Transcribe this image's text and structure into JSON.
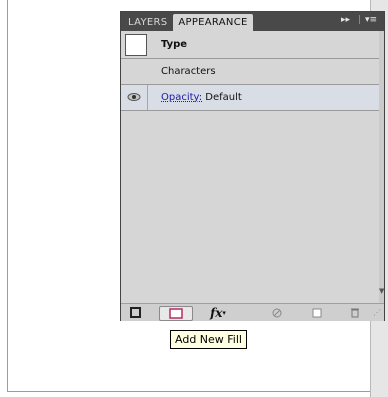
{
  "panel": {
    "tabs": [
      {
        "label": "LAYERS"
      },
      {
        "label": "APPEARANCE"
      }
    ],
    "controls": {
      "collapse": "▸▸",
      "menu": "▾≡"
    },
    "rows": [
      {
        "label": "Type"
      },
      {
        "label": "Characters"
      },
      {
        "label_prefix": "Opacity:",
        "label_value": "Default"
      }
    ],
    "bottom_bar": {
      "fx_label": "fx"
    }
  },
  "tooltip": {
    "text": "Add New Fill"
  },
  "colors": {
    "panel_bg": "#d6d6d6",
    "tab_bar_bg": "#494949",
    "link": "#1a1aa6",
    "tooltip_bg": "#ffffe1"
  }
}
